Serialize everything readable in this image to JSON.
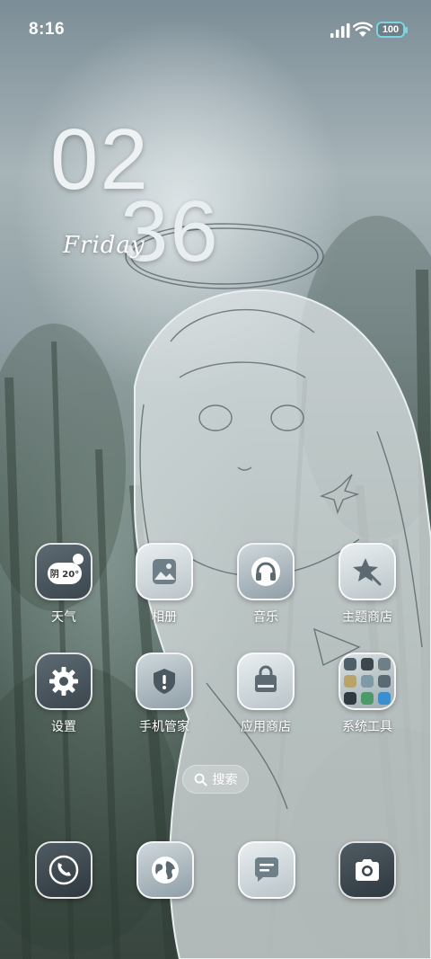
{
  "status_bar": {
    "time": "8:16",
    "battery_level": "100"
  },
  "clock_widget": {
    "hours": "02",
    "minutes": "36",
    "day": "Friday"
  },
  "apps": {
    "row1": [
      {
        "label": "天气",
        "icon": "weather-icon",
        "weather_text": "阴 20°"
      },
      {
        "label": "相册",
        "icon": "gallery-icon"
      },
      {
        "label": "音乐",
        "icon": "headphones-icon"
      },
      {
        "label": "主题商店",
        "icon": "theme-star-icon"
      }
    ],
    "row2": [
      {
        "label": "设置",
        "icon": "gear-icon"
      },
      {
        "label": "手机管家",
        "icon": "shield-icon"
      },
      {
        "label": "应用商店",
        "icon": "shopping-bag-icon"
      },
      {
        "label": "系统工具",
        "icon": "folder-icon"
      }
    ]
  },
  "search": {
    "label": "搜索",
    "icon": "search-icon"
  },
  "dock": [
    {
      "name": "phone",
      "icon": "phone-icon"
    },
    {
      "name": "browser",
      "icon": "globe-icon"
    },
    {
      "name": "messages",
      "icon": "message-icon"
    },
    {
      "name": "camera",
      "icon": "camera-icon"
    }
  ],
  "colors": {
    "battery_accent": "#7ad6e6",
    "icon_dark": "#3b464d",
    "icon_light": "#e9eef0"
  }
}
